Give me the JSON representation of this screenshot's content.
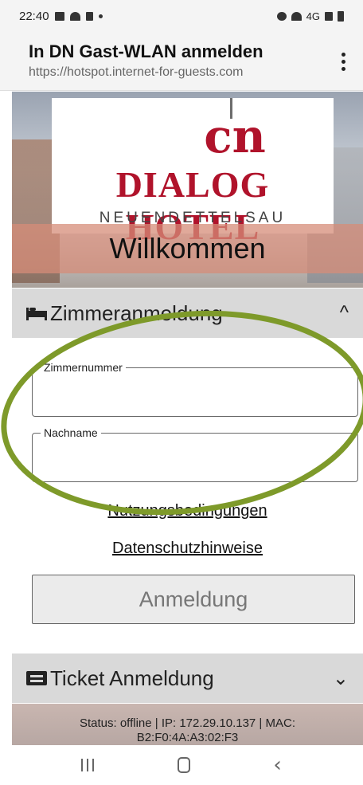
{
  "status_bar": {
    "time": "22:40",
    "net_label": "4G"
  },
  "header": {
    "title": "In DN Gast-WLAN anmelden",
    "url": "https://hotspot.internet-for-guests.com"
  },
  "logo": {
    "mark": "cn",
    "name": "DIALOG HOTEL",
    "sub": "NEUENDETTELSAU"
  },
  "welcome": "Willkommen",
  "room_login": {
    "title": "Zimmeranmeldung",
    "chevron": "^"
  },
  "fields": [
    {
      "label": "Zimmernummer",
      "value": ""
    },
    {
      "label": "Nachname",
      "value": ""
    }
  ],
  "links": {
    "terms": "Nutzungsbedingungen",
    "privacy": "Datenschutzhinweise"
  },
  "login_button": "Anmeldung",
  "ticket_login": {
    "title": "Ticket Anmeldung",
    "chevron": "⌄"
  },
  "footer": {
    "status_line1": "Status: offline | IP: 172.29.10.137 | MAC:",
    "status_line2": "B2:F0:4A:A3:02:F3"
  },
  "annotation": {
    "color": "#7e9a2a"
  }
}
